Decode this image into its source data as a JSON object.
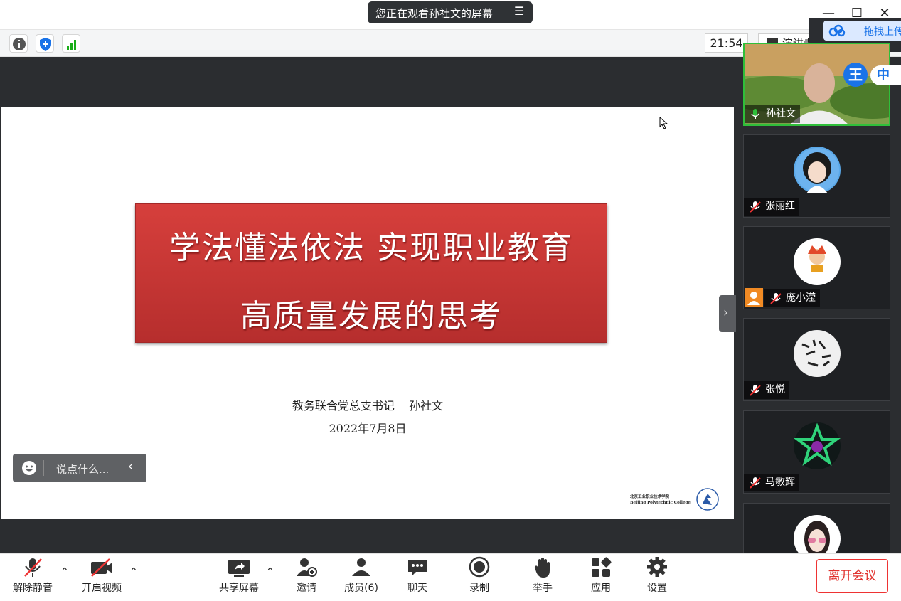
{
  "window": {
    "sharing_notice": "您正在观看孙社文的屏幕",
    "clock": "21:54",
    "speaker_view_label": "演讲者",
    "upload_label": "拖拽上传"
  },
  "slide": {
    "title_line1": "学法懂法依法  实现职业教育",
    "title_line2": "高质量发展的思考",
    "author": "教务联合党总支书记    孙社文",
    "date": "2022年7月8日",
    "logo_cn": "北京工业职业技术学院",
    "logo_en": "Beijing Polytechnic College"
  },
  "chat": {
    "placeholder": "说点什么..."
  },
  "participants": [
    {
      "name": "孙社文",
      "mic": "on"
    },
    {
      "name": "张丽红",
      "mic": "muted"
    },
    {
      "name": "庞小滢",
      "mic": "muted"
    },
    {
      "name": "张悦",
      "mic": "muted"
    },
    {
      "name": "马敏辉",
      "mic": "muted"
    },
    {
      "name": "",
      "mic": "muted"
    }
  ],
  "ime": {
    "label1": "王",
    "label2": "中"
  },
  "bottom": {
    "unmute": "解除静音",
    "start_video": "开启视频",
    "share_screen": "共享屏幕",
    "invite": "邀请",
    "members": "成员(6)",
    "chat": "聊天",
    "record": "录制",
    "raise_hand": "举手",
    "apps": "应用",
    "settings": "设置",
    "leave": "离开会议"
  },
  "colors": {
    "accent_green": "#1aad19",
    "leave_red": "#e0302c",
    "banner_red": "#c83634"
  }
}
